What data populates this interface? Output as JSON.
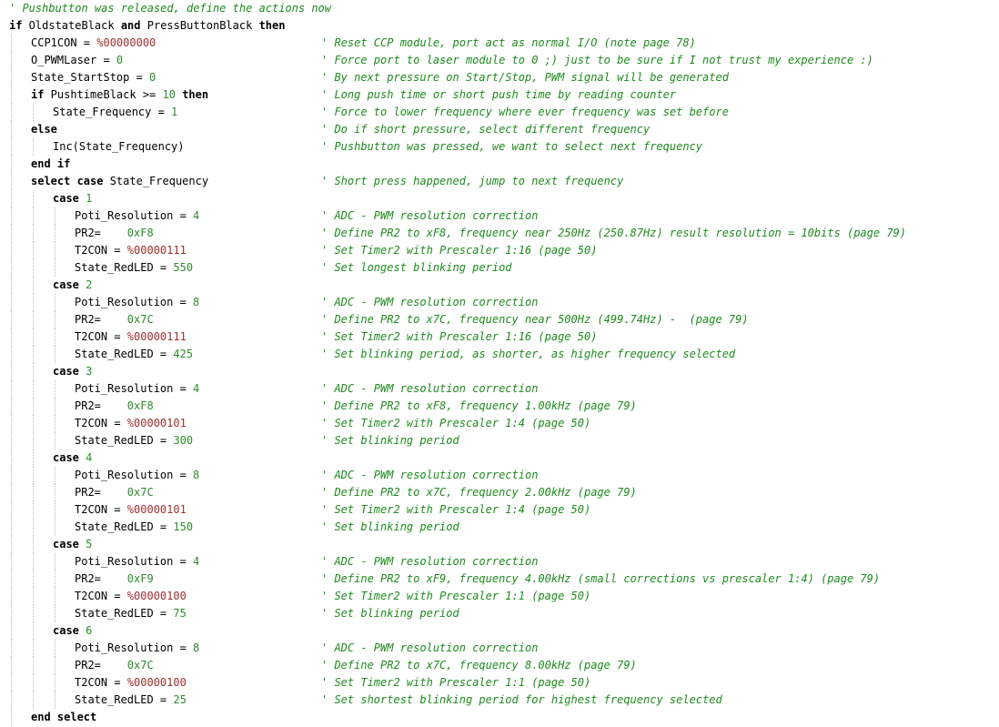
{
  "lines": [
    {
      "indent": 0,
      "comment": "' Pushbutton was released, define the actions now"
    },
    {
      "indent": 0,
      "kw1": "if",
      "t1": " OldstateBlack ",
      "kw2": "and",
      "t2": " PressButtonBlack ",
      "kw3": "then"
    },
    {
      "indent": 1,
      "t1": "CCP1CON = ",
      "bin": "%00000000",
      "comment": "' Reset CCP module, port act as normal I/O (note page 78)"
    },
    {
      "indent": 1,
      "t1": "O_PWMLaser = ",
      "num": "0",
      "comment": "' Force port to laser module to 0 ;) just to be sure if I not trust my experience :)"
    },
    {
      "indent": 1,
      "t1": "State_StartStop = ",
      "num": "0",
      "comment": "' By next pressure on Start/Stop, PWM signal will be generated"
    },
    {
      "indent": 1,
      "kw1": "if",
      "t1": " PushtimeBlack >= ",
      "num": "10",
      "t2": " ",
      "kw2": "then",
      "comment": "' Long push time or short push time by reading counter"
    },
    {
      "indent": 2,
      "t1": "State_Frequency = ",
      "num": "1",
      "comment": "' Force to lower frequency where ever frequency was set before"
    },
    {
      "indent": 1,
      "kw1": "else",
      "comment": "' Do if short pressure, select different frequency"
    },
    {
      "indent": 2,
      "t1": "Inc(State_Frequency)",
      "comment": "' Pushbutton was pressed, we want to select next frequency"
    },
    {
      "indent": 1,
      "kw1": "end if"
    },
    {
      "indent": 1,
      "kw1": "select case",
      "t1": " State_Frequency",
      "comment": "' Short press happened, jump to next frequency"
    },
    {
      "indent": 2,
      "kw1": "case",
      "t1": " ",
      "num": "1"
    },
    {
      "indent": 3,
      "t1": "Poti_Resolution = ",
      "num": "4",
      "comment": "' ADC - PWM resolution correction"
    },
    {
      "indent": 3,
      "t1": "PR2=    ",
      "hex": "0xF8",
      "comment": "' Define PR2 to xF8, frequency near 250Hz (250.87Hz) result resolution = 10bits (page 79)"
    },
    {
      "indent": 3,
      "t1": "T2CON = ",
      "bin": "%00000111",
      "comment": "' Set Timer2 with Prescaler 1:16 (page 50)"
    },
    {
      "indent": 3,
      "t1": "State_RedLED = ",
      "num": "550",
      "comment": "' Set longest blinking period"
    },
    {
      "indent": 2,
      "kw1": "case",
      "t1": " ",
      "num": "2"
    },
    {
      "indent": 3,
      "t1": "Poti_Resolution = ",
      "num": "8",
      "comment": "' ADC - PWM resolution correction"
    },
    {
      "indent": 3,
      "t1": "PR2=    ",
      "hex": "0x7C",
      "comment": "' Define PR2 to x7C, frequency near 500Hz (499.74Hz) -  (page 79)"
    },
    {
      "indent": 3,
      "t1": "T2CON = ",
      "bin": "%00000111",
      "comment": "' Set Timer2 with Prescaler 1:16 (page 50)"
    },
    {
      "indent": 3,
      "t1": "State_RedLED = ",
      "num": "425",
      "comment": "' Set blinking period, as shorter, as higher frequency selected"
    },
    {
      "indent": 2,
      "kw1": "case",
      "t1": " ",
      "num": "3"
    },
    {
      "indent": 3,
      "t1": "Poti_Resolution = ",
      "num": "4",
      "comment": "' ADC - PWM resolution correction"
    },
    {
      "indent": 3,
      "t1": "PR2=    ",
      "hex": "0xF8",
      "comment": "' Define PR2 to xF8, frequency 1.00kHz (page 79)"
    },
    {
      "indent": 3,
      "t1": "T2CON = ",
      "bin": "%00000101",
      "comment": "' Set Timer2 with Prescaler 1:4 (page 50)"
    },
    {
      "indent": 3,
      "t1": "State_RedLED = ",
      "num": "300",
      "comment": "' Set blinking period"
    },
    {
      "indent": 2,
      "kw1": "case",
      "t1": " ",
      "num": "4"
    },
    {
      "indent": 3,
      "t1": "Poti_Resolution = ",
      "num": "8",
      "comment": "' ADC - PWM resolution correction"
    },
    {
      "indent": 3,
      "t1": "PR2=    ",
      "hex": "0x7C",
      "comment": "' Define PR2 to x7C, frequency 2.00kHz (page 79)"
    },
    {
      "indent": 3,
      "t1": "T2CON = ",
      "bin": "%00000101",
      "comment": "' Set Timer2 with Prescaler 1:4 (page 50)"
    },
    {
      "indent": 3,
      "t1": "State_RedLED = ",
      "num": "150",
      "comment": "' Set blinking period"
    },
    {
      "indent": 2,
      "kw1": "case",
      "t1": " ",
      "num": "5"
    },
    {
      "indent": 3,
      "t1": "Poti_Resolution = ",
      "num": "4",
      "comment": "' ADC - PWM resolution correction"
    },
    {
      "indent": 3,
      "t1": "PR2=    ",
      "hex": "0xF9",
      "comment": "' Define PR2 to xF9, frequency 4.00kHz (small corrections vs prescaler 1:4) (page 79)"
    },
    {
      "indent": 3,
      "t1": "T2CON = ",
      "bin": "%00000100",
      "comment": "' Set Timer2 with Prescaler 1:1 (page 50)"
    },
    {
      "indent": 3,
      "t1": "State_RedLED = ",
      "num": "75",
      "comment": "' Set blinking period"
    },
    {
      "indent": 2,
      "kw1": "case",
      "t1": " ",
      "num": "6"
    },
    {
      "indent": 3,
      "t1": "Poti_Resolution = ",
      "num": "8",
      "comment": "' ADC - PWM resolution correction"
    },
    {
      "indent": 3,
      "t1": "PR2=    ",
      "hex": "0x7C",
      "comment": "' Define PR2 to x7C, frequency 8.00kHz (page 79)"
    },
    {
      "indent": 3,
      "t1": "T2CON = ",
      "bin": "%00000100",
      "comment": "' Set Timer2 with Prescaler 1:1 (page 50)"
    },
    {
      "indent": 3,
      "t1": "State_RedLED = ",
      "num": "25",
      "comment": "' Set shortest blinking period for highest frequency selected"
    },
    {
      "indent": 1,
      "kw1": "end select"
    }
  ],
  "colors": {
    "background": "#ffffff",
    "code": "#000000",
    "comment": "#1e8a1e",
    "number": "#2e8b2e",
    "binary": "#a03030",
    "guide": "#b8b8b8"
  }
}
